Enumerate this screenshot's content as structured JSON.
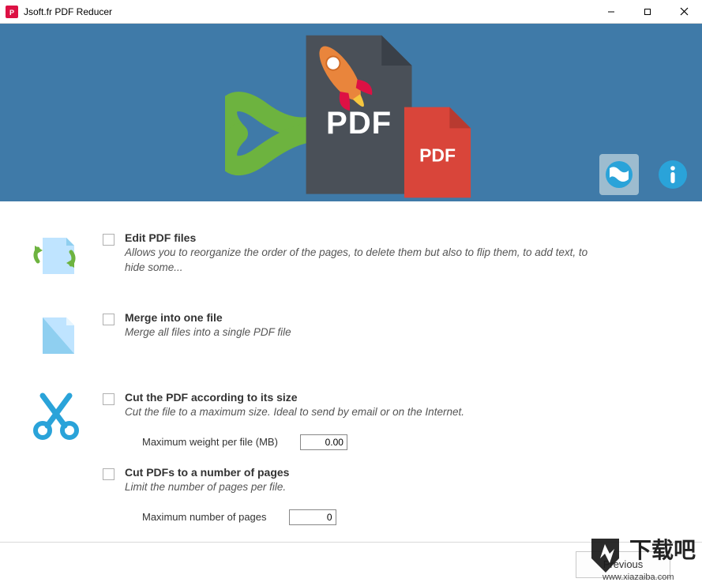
{
  "window": {
    "title": "Jsoft.fr PDF Reducer"
  },
  "options": {
    "edit": {
      "title": "Edit PDF files",
      "desc": "Allows you to reorganize the order of the pages, to delete them but also to flip them, to add text, to hide some..."
    },
    "merge": {
      "title": "Merge into one file",
      "desc": "Merge all files into a single PDF file"
    },
    "cut_size": {
      "title": "Cut the PDF according to its size",
      "desc": "Cut the file to a maximum size. Ideal to send by email or on the Internet.",
      "param_label": "Maximum weight per file (MB)",
      "param_value": "0.00"
    },
    "cut_pages": {
      "title": "Cut PDFs to a number of pages",
      "desc": "Limit the number of pages per file.",
      "param_label": "Maximum number of pages",
      "param_value": "0"
    }
  },
  "footer": {
    "previous": "Previous"
  },
  "watermark": {
    "text": "下载吧",
    "url": "www.xiazaiba.com"
  }
}
